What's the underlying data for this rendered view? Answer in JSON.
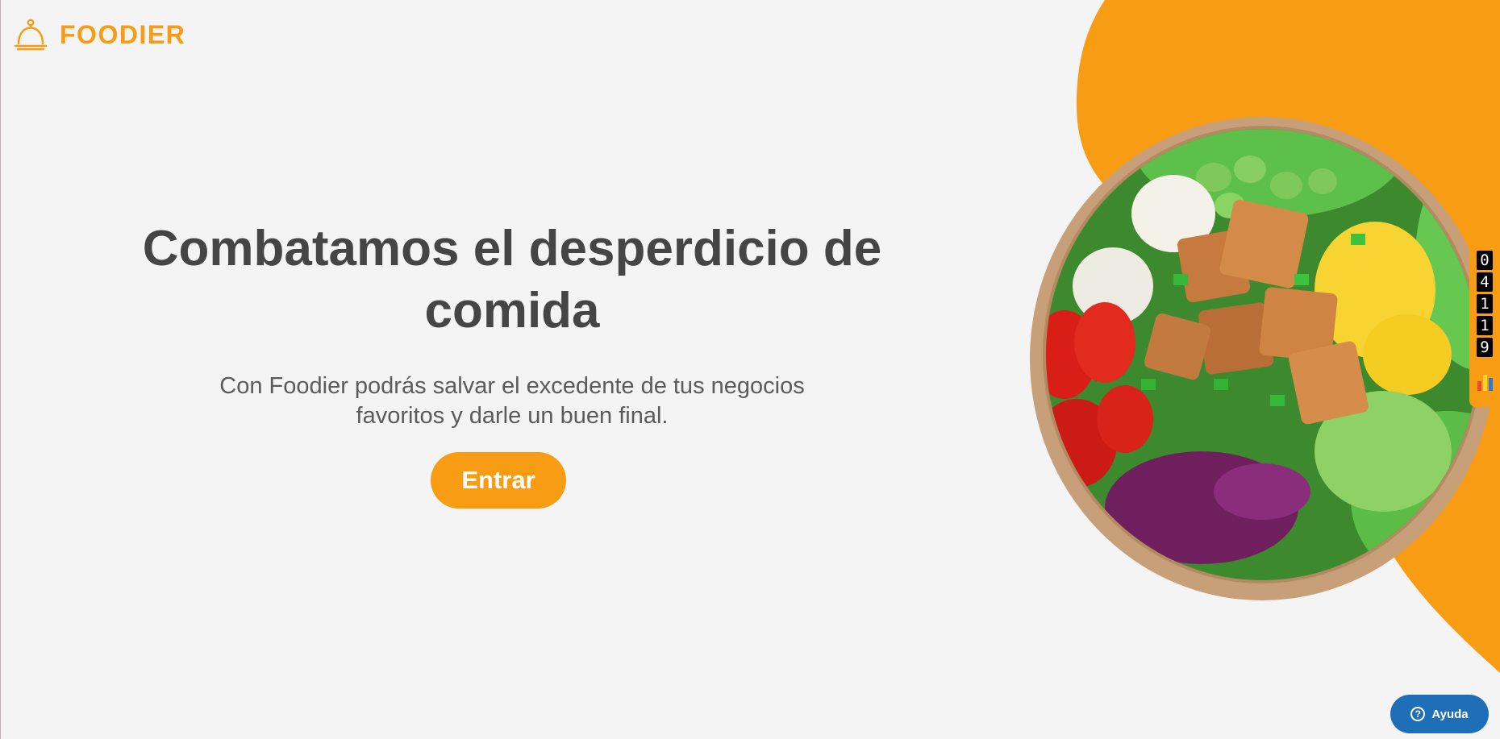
{
  "header": {
    "brand_name": "FOODIER",
    "logo_icon": "service-bell-icon"
  },
  "hero": {
    "title_line1": "Combatamos el desperdicio de",
    "title_line2": "comida",
    "subtitle_line1": "Con Foodier podrás salvar el excedente de tus negocios",
    "subtitle_line2": "favoritos y darle un buen final.",
    "cta_label": "Entrar"
  },
  "visitor_counter": {
    "digits": [
      "0",
      "4",
      "1",
      "1",
      "9"
    ],
    "icon": "bar-chart-icon"
  },
  "help": {
    "label": "Ayuda",
    "icon": "question-mark-icon"
  },
  "colors": {
    "accent": "#f89c13",
    "heading": "#454545",
    "body_text": "#5b5b5b",
    "background": "#f4f4f4",
    "help_blue": "#1f6fb8"
  }
}
